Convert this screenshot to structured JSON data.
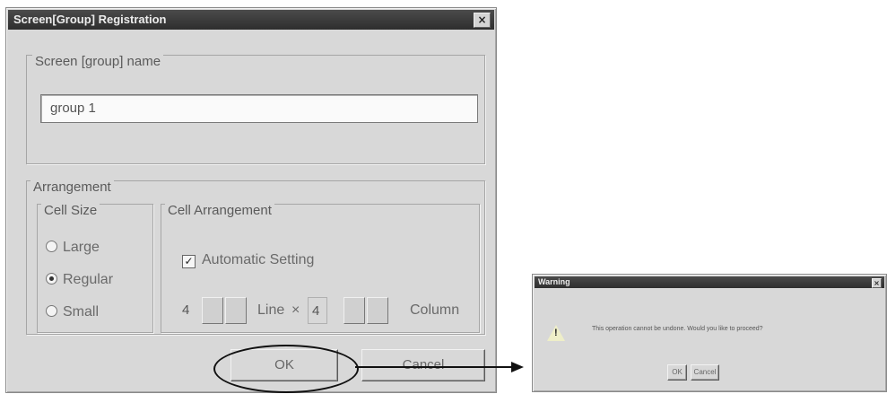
{
  "dialog": {
    "title": "Screen[Group] Registration",
    "close_glyph": "×",
    "name_group_label": "Screen [group] name",
    "name_value": "group 1",
    "arrangement_label": "Arrangement",
    "cell_size_label": "Cell Size",
    "cell_size_options": [
      {
        "label": "Large",
        "selected": false
      },
      {
        "label": "Regular",
        "selected": true
      },
      {
        "label": "Small",
        "selected": false
      }
    ],
    "cell_arrangement_label": "Cell Arrangement",
    "auto_setting_label": "Automatic Setting",
    "auto_setting_checked": true,
    "check_glyph": "✓",
    "line_value": "4",
    "line_label": "Line",
    "line_separator": "×",
    "column_value": "4",
    "column_label": "Column",
    "ok_label": "OK",
    "cancel_label": "Cancel"
  },
  "warning": {
    "title": "Warning",
    "close_glyph": "×",
    "icon": "exclamation-triangle-icon",
    "icon_glyph": "!",
    "message": "This operation cannot be undone. Would you like to proceed?",
    "ok_label": "OK",
    "cancel_label": "Cancel"
  },
  "annotation": {
    "highlight_target": "OK",
    "arrow_color": "#111111"
  }
}
